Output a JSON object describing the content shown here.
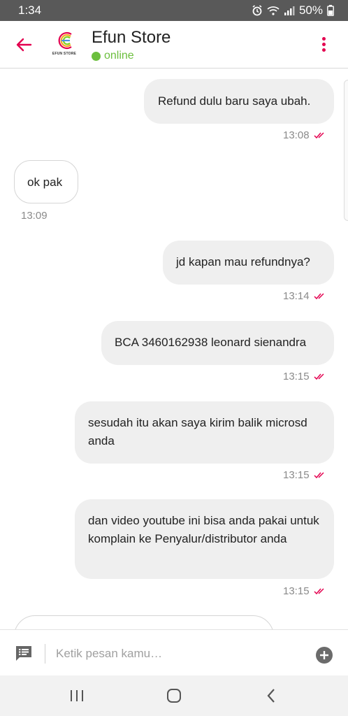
{
  "status_bar": {
    "time": "1:34",
    "battery": "50%",
    "icons": [
      "alarm-icon",
      "wifi-icon",
      "signal-icon",
      "battery-icon"
    ]
  },
  "header": {
    "store_name": "Efun Store",
    "status": "online",
    "logo_text": "EFUN STORE",
    "accent_color": "#e3004f",
    "online_color": "#6cbf3e"
  },
  "messages": [
    {
      "direction": "out",
      "text": "Refund dulu baru saya ubah.",
      "time": "13:08"
    },
    {
      "direction": "in",
      "text": "ok pak",
      "time": "13:09"
    },
    {
      "direction": "out",
      "text": "jd kapan mau refundnya?",
      "time": "13:14"
    },
    {
      "direction": "out",
      "text": "BCA 3460162938 leonard sienandra",
      "time": "13:15"
    },
    {
      "direction": "out",
      "text": "sesudah itu akan saya kirim balik microsd anda",
      "time": "13:15"
    },
    {
      "direction": "out",
      "text": "dan video youtube ini bisa anda pakai untuk komplain ke Penyalur/distributor anda",
      "time": "13:15"
    }
  ],
  "input": {
    "placeholder": "Ketik pesan kamu…"
  }
}
